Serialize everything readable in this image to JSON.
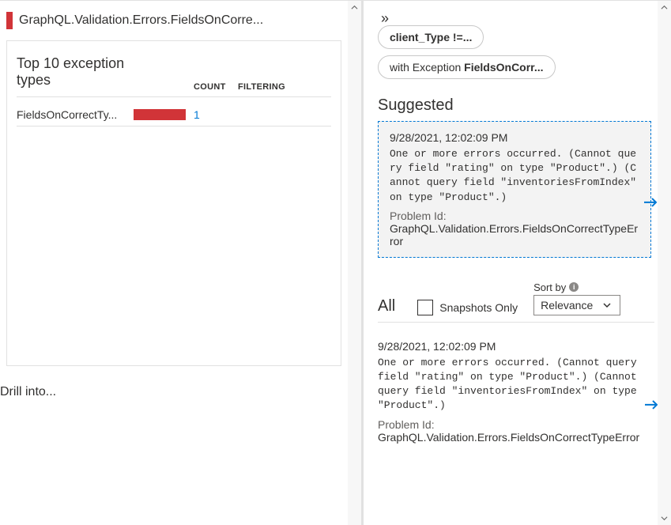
{
  "left": {
    "title": "GraphQL.Validation.Errors.FieldsOnCorre...",
    "section_title": "Top 10 exception types",
    "count_header": "COUNT",
    "filter_header": "FILTERING",
    "rows": [
      {
        "name": "FieldsOnCorrectTy...",
        "count": "1"
      }
    ],
    "drill_label": "Drill into..."
  },
  "right": {
    "expand_glyph": "»",
    "pills": {
      "client_type": "client_Type !=...",
      "with_exception_prefix": "with Exception ",
      "with_exception_value": "FieldsOnCorr..."
    },
    "suggested_title": "Suggested",
    "suggested": {
      "timestamp": "9/28/2021, 12:02:09 PM",
      "message": "One or more errors occurred. (Cannot query field \"rating\" on type \"Product\".) (Cannot query field \"inventoriesFromIndex\" on type \"Product\".)",
      "problem_label": "Problem Id:",
      "problem_id": "GraphQL.Validation.Errors.FieldsOnCorrectTypeError"
    },
    "all_label": "All",
    "snapshots_label": "Snapshots Only",
    "sort_by_label": "Sort by",
    "sort_value": "Relevance",
    "results": [
      {
        "timestamp": "9/28/2021, 12:02:09 PM",
        "message": "One or more errors occurred. (Cannot query field \"rating\" on type \"Product\".) (Cannot query field \"inventoriesFromIndex\" on type \"Product\".)",
        "problem_label": "Problem Id:",
        "problem_id": "GraphQL.Validation.Errors.FieldsOnCorrectTypeError"
      }
    ]
  }
}
